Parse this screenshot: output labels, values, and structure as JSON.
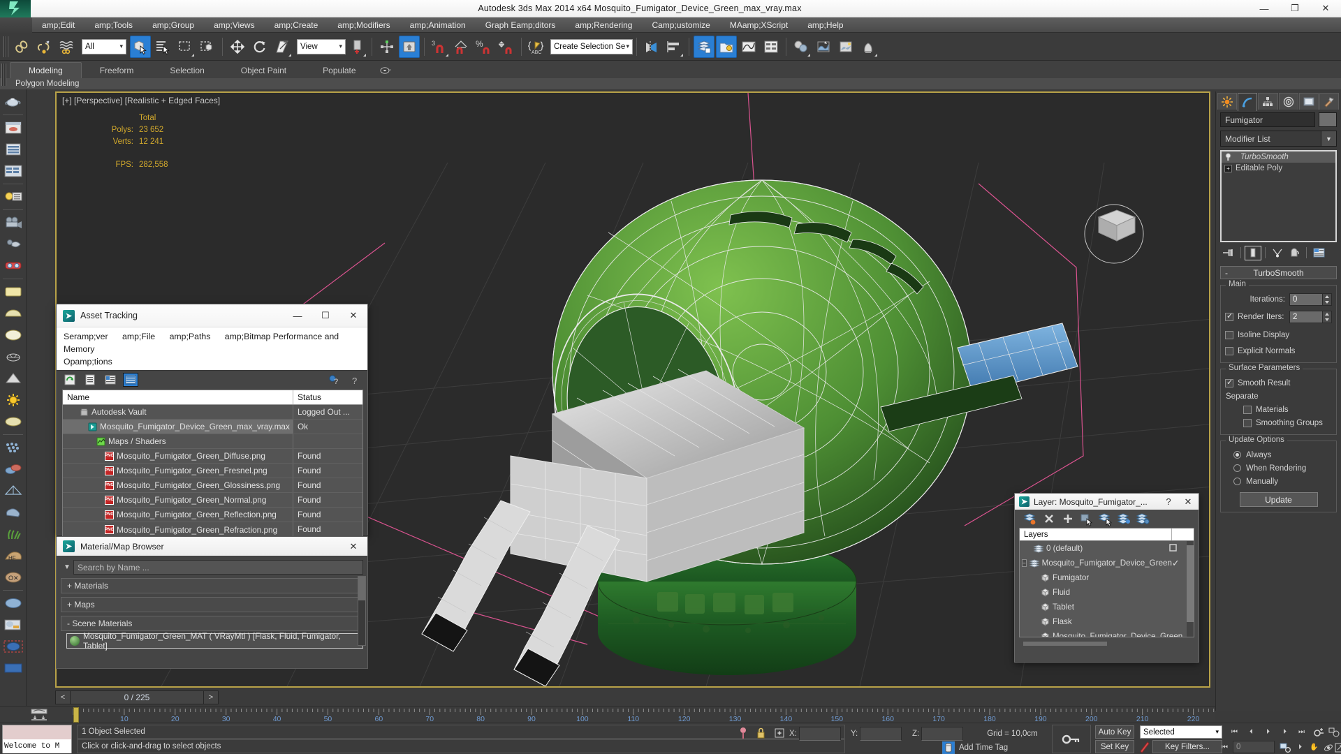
{
  "titlebar": {
    "app": "Autodesk 3ds Max  2014 x64",
    "file": "Mosquito_Fumigator_Device_Green_max_vray.max",
    "title": "Autodesk 3ds Max  2014 x64     Mosquito_Fumigator_Device_Green_max_vray.max",
    "minimize": "—",
    "maximize": "❐",
    "close": "✕"
  },
  "menubar": {
    "items": [
      {
        "label": "amp;Edit"
      },
      {
        "label": "amp;Tools"
      },
      {
        "label": "amp;Group"
      },
      {
        "label": "amp;Views"
      },
      {
        "label": "amp;Create"
      },
      {
        "label": "amp;Modifiers"
      },
      {
        "label": "amp;Animation"
      },
      {
        "label": "Graph Eamp;ditors"
      },
      {
        "label": "amp;Rendering"
      },
      {
        "label": "Camp;ustomize"
      },
      {
        "label": "MAamp;XScript"
      },
      {
        "label": "amp;Help"
      }
    ]
  },
  "toolbar": {
    "selection_filter": "All",
    "ref_coord_system": "View",
    "named_selection_sets": "Create Selection Se",
    "snap_angle": "3",
    "snap_percent": "%"
  },
  "ribbon": {
    "tabs": [
      {
        "label": "Modeling",
        "active": true
      },
      {
        "label": "Freeform",
        "active": false
      },
      {
        "label": "Selection",
        "active": false
      },
      {
        "label": "Object Paint",
        "active": false
      },
      {
        "label": "Populate",
        "active": false
      }
    ],
    "subtitle": "Polygon Modeling"
  },
  "viewport": {
    "label": "[+] [Perspective] [Realistic + Edged Faces]",
    "stats": {
      "header": "Total",
      "polys_label": "Polys:",
      "polys_value": "23 652",
      "verts_label": "Verts:",
      "verts_value": "12 241",
      "fps_label": "FPS:",
      "fps_value": "282,558"
    },
    "border_color": "#b8a248",
    "background_color": "#2b2b2b"
  },
  "asset_tracking": {
    "title": "Asset Tracking",
    "menus": [
      "Seramp;ver",
      "amp;File",
      "amp;Paths",
      "amp;Bitmap Performance and Memory",
      "Opamp;tions"
    ],
    "columns": [
      "Name",
      "Status"
    ],
    "rows": [
      {
        "name": "Autodesk Vault",
        "status": "Logged Out ...",
        "indent": 1,
        "icon": "vault-icon",
        "selected": false
      },
      {
        "name": "Mosquito_Fumigator_Device_Green_max_vray.max",
        "status": "Ok",
        "indent": 2,
        "icon": "max-file-icon",
        "selected": true
      },
      {
        "name": "Maps / Shaders",
        "status": "",
        "indent": 3,
        "icon": "maps-icon",
        "selected": false
      },
      {
        "name": "Mosquito_Fumigator_Green_Diffuse.png",
        "status": "Found",
        "indent": 4,
        "icon": "png-icon",
        "selected": false
      },
      {
        "name": "Mosquito_Fumigator_Green_Fresnel.png",
        "status": "Found",
        "indent": 4,
        "icon": "png-icon",
        "selected": false
      },
      {
        "name": "Mosquito_Fumigator_Green_Glossiness.png",
        "status": "Found",
        "indent": 4,
        "icon": "png-icon",
        "selected": false
      },
      {
        "name": "Mosquito_Fumigator_Green_Normal.png",
        "status": "Found",
        "indent": 4,
        "icon": "png-icon",
        "selected": false
      },
      {
        "name": "Mosquito_Fumigator_Green_Reflection.png",
        "status": "Found",
        "indent": 4,
        "icon": "png-icon",
        "selected": false
      },
      {
        "name": "Mosquito_Fumigator_Green_Refraction.png",
        "status": "Found",
        "indent": 4,
        "icon": "png-icon",
        "selected": false
      }
    ],
    "titlebar_buttons": {
      "minimize": "—",
      "maximize": "☐",
      "close": "✕"
    }
  },
  "material_browser": {
    "title": "Material/Map Browser",
    "close": "✕",
    "search_placeholder": "Search by Name ...",
    "groups": [
      {
        "label": "+ Materials",
        "expanded": false
      },
      {
        "label": "+ Maps",
        "expanded": false
      },
      {
        "label": "- Scene Materials",
        "expanded": true
      }
    ],
    "scene_material": "Mosquito_Fumigator_Green_MAT  ( VRayMtl )  [Flask, Fluid, Fumigator, Tablet]"
  },
  "layer_dialog": {
    "title": "Layer: Mosquito_Fumigator_...",
    "help": "?",
    "close": "✕",
    "header": "Layers",
    "rows": [
      {
        "label": "0 (default)",
        "indent": 1,
        "icon": "layer-icon",
        "mark": "box",
        "expander": false
      },
      {
        "label": "Mosquito_Fumigator_Device_Green",
        "indent": 0,
        "icon": "layer-icon",
        "mark": "check",
        "expander": true
      },
      {
        "label": "Fumigator",
        "indent": 2,
        "icon": "object-icon",
        "mark": "",
        "expander": false
      },
      {
        "label": "Fluid",
        "indent": 2,
        "icon": "object-icon",
        "mark": "",
        "expander": false
      },
      {
        "label": "Tablet",
        "indent": 2,
        "icon": "object-icon",
        "mark": "",
        "expander": false
      },
      {
        "label": "Flask",
        "indent": 2,
        "icon": "object-icon",
        "mark": "",
        "expander": false
      },
      {
        "label": "Mosquito_Fumigator_Device_Green",
        "indent": 2,
        "icon": "object-icon",
        "mark": "",
        "expander": false
      }
    ]
  },
  "command_panel": {
    "tabs": [
      "create-tab",
      "modify-tab",
      "hierarchy-tab",
      "motion-tab",
      "display-tab",
      "utilities-tab"
    ],
    "active_tab_index": 1,
    "object_name": "Fumigator",
    "modifier_list": "Modifier List",
    "stack": [
      {
        "label": "TurboSmooth",
        "selected": true,
        "italic": true,
        "has_bulb": true
      },
      {
        "label": "Editable Poly",
        "selected": false,
        "italic": false,
        "has_plus": true
      }
    ],
    "rollout": {
      "title": "TurboSmooth",
      "collapse_sign": "-",
      "main_group": "Main",
      "iterations_label": "Iterations:",
      "iterations_value": "0",
      "render_iters_label": "Render Iters:",
      "render_iters_value": "2",
      "render_iters_checked": true,
      "isoline_label": "Isoline Display",
      "isoline_checked": false,
      "explicit_label": "Explicit Normals",
      "explicit_checked": false,
      "surface_group": "Surface Parameters",
      "smooth_result_label": "Smooth Result",
      "smooth_result_checked": true,
      "separate_label": "Separate",
      "materials_label": "Materials",
      "materials_checked": false,
      "smoothing_groups_label": "Smoothing Groups",
      "smoothing_groups_checked": false,
      "update_group": "Update Options",
      "always_label": "Always",
      "when_rendering_label": "When Rendering",
      "manually_label": "Manually",
      "selected_update": "Always",
      "update_button": "Update"
    }
  },
  "timeline": {
    "current_frame_display": "0 / 225",
    "prev_arrow": "<",
    "next_arrow": ">",
    "ticks": [
      {
        "label": "10",
        "value": 10
      },
      {
        "label": "20",
        "value": 20
      },
      {
        "label": "30",
        "value": 30
      },
      {
        "label": "40",
        "value": 40
      },
      {
        "label": "50",
        "value": 50
      },
      {
        "label": "60",
        "value": 60
      },
      {
        "label": "70",
        "value": 70
      },
      {
        "label": "80",
        "value": 80
      },
      {
        "label": "90",
        "value": 90
      },
      {
        "label": "100",
        "value": 100
      },
      {
        "label": "110",
        "value": 110
      },
      {
        "label": "120",
        "value": 120
      },
      {
        "label": "130",
        "value": 130
      },
      {
        "label": "140",
        "value": 140
      },
      {
        "label": "150",
        "value": 150
      },
      {
        "label": "160",
        "value": 160
      },
      {
        "label": "170",
        "value": 170
      },
      {
        "label": "180",
        "value": 180
      },
      {
        "label": "190",
        "value": 190
      },
      {
        "label": "200",
        "value": 200
      },
      {
        "label": "210",
        "value": 210
      },
      {
        "label": "220",
        "value": 220
      }
    ],
    "range_max": 225
  },
  "statusbar": {
    "maxlistener_text": "Welcome to M",
    "selection_status": "1 Object Selected",
    "prompt": "Click or click-and-drag to select objects",
    "x_label": "X:",
    "x_value": "",
    "y_label": "Y:",
    "y_value": "",
    "z_label": "Z:",
    "z_value": "",
    "grid": "Grid = 10,0cm",
    "add_time_tag": "Add Time Tag",
    "auto_key": "Auto Key",
    "set_key": "Set Key",
    "key_mode_selection": "Selected",
    "key_filters": "Key Filters...",
    "current_frame": "0"
  },
  "colors": {
    "accent_blue": "#2a7fd4",
    "viewport_border": "#b8a248",
    "panel_bg": "#3b3b3b",
    "dialog_bg": "#454545",
    "stat_text": "#d1a82c",
    "mesh_green": "#4e8f34",
    "mesh_wire": "#e8e8e8",
    "grid_pink": "#d9538f"
  }
}
